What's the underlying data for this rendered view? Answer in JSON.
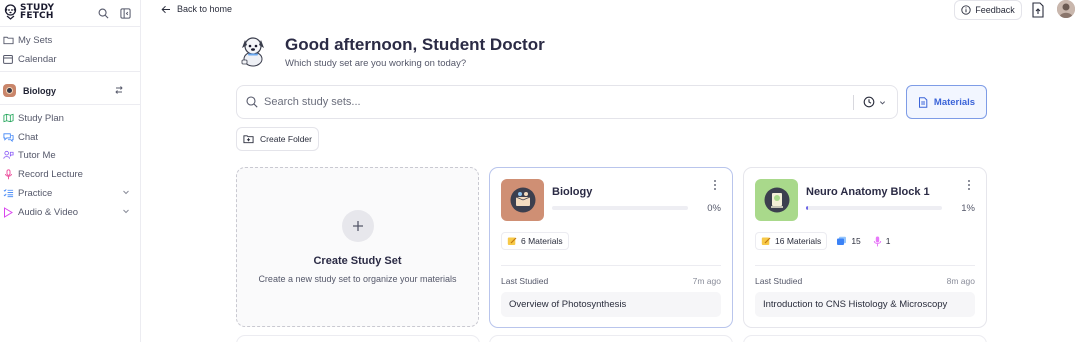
{
  "brand": {
    "name_line1": "STUDY",
    "name_line2": "FETCH"
  },
  "sidebar": {
    "top_items": [
      {
        "label": "My Sets",
        "icon": "folder-icon"
      },
      {
        "label": "Calendar",
        "icon": "calendar-icon"
      }
    ],
    "current_set": {
      "label": "Biology",
      "icon": "swap-icon"
    },
    "set_items": [
      {
        "label": "Study Plan",
        "icon": "map-icon",
        "color": "#22a55a"
      },
      {
        "label": "Chat",
        "icon": "chat-icon",
        "color": "#3b82f6"
      },
      {
        "label": "Tutor Me",
        "icon": "tutor-icon",
        "color": "#8b5cf6"
      },
      {
        "label": "Record Lecture",
        "icon": "microphone-icon",
        "color": "#ec4899"
      },
      {
        "label": "Practice",
        "icon": "list-icon",
        "color": "#3b82f6",
        "has_chevron": true
      },
      {
        "label": "Audio & Video",
        "icon": "play-icon",
        "color": "#d946ef",
        "has_chevron": true
      }
    ]
  },
  "topbar": {
    "back_label": "Back to home",
    "feedback_label": "Feedback"
  },
  "greeting": {
    "title": "Good afternoon, Student Doctor",
    "subtitle": "Which study set are you working on today?"
  },
  "search": {
    "placeholder": "Search study sets..."
  },
  "materials_button": "Materials",
  "create_folder_label": "Create Folder",
  "create_card": {
    "title": "Create Study Set",
    "subtitle": "Create a new study set to organize your materials"
  },
  "study_sets": [
    {
      "title": "Biology",
      "progress_label": "0%",
      "progress": 0,
      "thumb_color": "#cf8f74",
      "chips": [
        {
          "icon": "note-icon",
          "label": "6 Materials"
        }
      ],
      "last_studied_label": "Last Studied",
      "last_studied_time": "7m ago",
      "last_item": "Overview of Photosynthesis"
    },
    {
      "title": "Neuro Anatomy Block 1",
      "progress_label": "1%",
      "progress": 0.01,
      "thumb_color": "#a9d98b",
      "chips": [
        {
          "icon": "note-icon",
          "label": "16 Materials"
        },
        {
          "icon": "cards-icon",
          "label": "15"
        },
        {
          "icon": "microphone-icon",
          "label": "1"
        }
      ],
      "last_studied_label": "Last Studied",
      "last_studied_time": "8m ago",
      "last_item": "Introduction to CNS Histology & Microscopy"
    }
  ],
  "colors": {
    "accent": "#3b64d8",
    "progress": "#6b63e6"
  }
}
